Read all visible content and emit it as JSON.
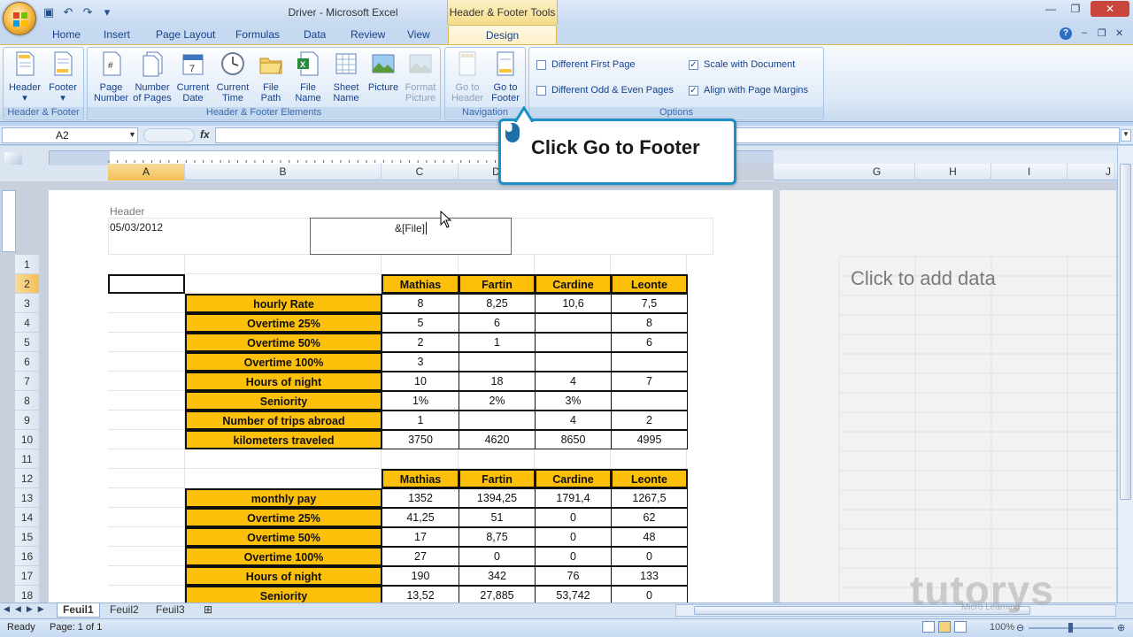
{
  "window": {
    "title": "Driver - Microsoft Excel",
    "contextual_tab": "Header & Footer Tools"
  },
  "ribbon_tabs": [
    "Home",
    "Insert",
    "Page Layout",
    "Formulas",
    "Data",
    "Review",
    "View"
  ],
  "active_tab": "Design",
  "groups": {
    "header_footer": {
      "label": "Header & Footer",
      "header": "Header",
      "footer": "Footer"
    },
    "elements": {
      "label": "Header & Footer Elements",
      "buttons": [
        {
          "l1": "Page",
          "l2": "Number"
        },
        {
          "l1": "Number",
          "l2": "of Pages"
        },
        {
          "l1": "Current",
          "l2": "Date"
        },
        {
          "l1": "Current",
          "l2": "Time"
        },
        {
          "l1": "File",
          "l2": "Path"
        },
        {
          "l1": "File",
          "l2": "Name"
        },
        {
          "l1": "Sheet",
          "l2": "Name"
        },
        {
          "l1": "Picture",
          "l2": ""
        },
        {
          "l1": "Format",
          "l2": "Picture"
        }
      ]
    },
    "navigation": {
      "label": "Navigation",
      "goto_header_1": "Go to",
      "goto_header_2": "Header",
      "goto_footer_1": "Go to",
      "goto_footer_2": "Footer"
    },
    "options": {
      "label": "Options",
      "diff_first": "Different First Page",
      "diff_odd_even": "Different Odd & Even Pages",
      "scale": "Scale with Document",
      "align": "Align with Page Margins",
      "check": "✓"
    }
  },
  "formula_bar": {
    "name_box": "A2",
    "fx": "fx",
    "value": ""
  },
  "columns": {
    "a": "A",
    "b": "B",
    "c": "C",
    "d": "D",
    "g": "G",
    "h": "H",
    "i": "I",
    "j": "J"
  },
  "page_header": {
    "label": "Header",
    "left": "05/03/2012",
    "center": "&[File]"
  },
  "right_page": {
    "add_data": "Click to add data"
  },
  "rows": [
    "1",
    "2",
    "3",
    "4",
    "5",
    "6",
    "7",
    "8",
    "9",
    "10",
    "11",
    "12",
    "13",
    "14",
    "15",
    "16",
    "17",
    "18"
  ],
  "table1": {
    "headers": [
      "Mathias",
      "Fartin",
      "Cardine",
      "Leonte"
    ],
    "rows": [
      {
        "label": "hourly Rate",
        "v": [
          "8",
          "8,25",
          "10,6",
          "7,5"
        ]
      },
      {
        "label": "Overtime 25%",
        "v": [
          "5",
          "6",
          "",
          "8"
        ]
      },
      {
        "label": "Overtime 50%",
        "v": [
          "2",
          "1",
          "",
          "6"
        ]
      },
      {
        "label": "Overtime 100%",
        "v": [
          "3",
          "",
          "",
          ""
        ]
      },
      {
        "label": "Hours of night",
        "v": [
          "10",
          "18",
          "4",
          "7"
        ]
      },
      {
        "label": "Seniority",
        "v": [
          "1%",
          "2%",
          "3%",
          ""
        ]
      },
      {
        "label": "Number of trips abroad",
        "v": [
          "1",
          "",
          "4",
          "2"
        ]
      },
      {
        "label": "kilometers traveled",
        "v": [
          "3750",
          "4620",
          "8650",
          "4995"
        ]
      }
    ]
  },
  "table2": {
    "headers": [
      "Mathias",
      "Fartin",
      "Cardine",
      "Leonte"
    ],
    "rows": [
      {
        "label": "monthly pay",
        "v": [
          "1352",
          "1394,25",
          "1791,4",
          "1267,5"
        ]
      },
      {
        "label": "Overtime 25%",
        "v": [
          "41,25",
          "51",
          "0",
          "62"
        ]
      },
      {
        "label": "Overtime  50%",
        "v": [
          "17",
          "8,75",
          "0",
          "48"
        ]
      },
      {
        "label": "Overtime  100%",
        "v": [
          "27",
          "0",
          "0",
          "0"
        ]
      },
      {
        "label": "Hours of night",
        "v": [
          "190",
          "342",
          "76",
          "133"
        ]
      },
      {
        "label": "Seniority",
        "v": [
          "13,52",
          "27,885",
          "53,742",
          "0"
        ]
      }
    ]
  },
  "callout": {
    "text": "Click Go to Footer"
  },
  "sheets": [
    "Feuil1",
    "Feuil2",
    "Feuil3"
  ],
  "active_sheet": "Feuil1",
  "status": {
    "ready": "Ready",
    "page": "Page: 1 of 1",
    "zoom": "100%"
  },
  "watermark": {
    "brand": "tutorys",
    "tagline": "Micro Learning"
  }
}
